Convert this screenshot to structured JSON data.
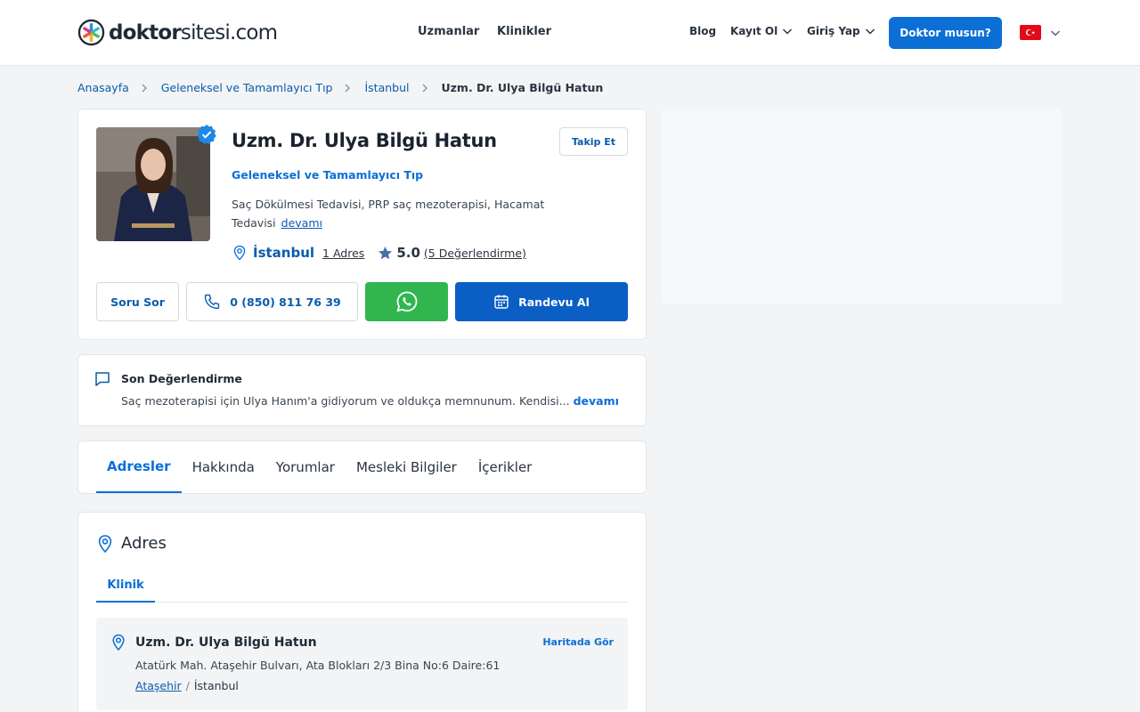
{
  "header": {
    "logo_bold": "doktor",
    "logo_light": "sitesi.com",
    "nav_center": [
      "Uzmanlar",
      "Klinikler"
    ],
    "blog": "Blog",
    "register": "Kayıt Ol",
    "login": "Giriş Yap",
    "doctor_cta": "Doktor musun?",
    "language_flag": "turkey-flag-icon"
  },
  "breadcrumb": [
    "Anasayfa",
    "Geleneksel ve Tamamlayıcı Tıp",
    "İstanbul",
    "Uzm. Dr. Ulya Bilgü Hatun"
  ],
  "profile": {
    "name": "Uzm. Dr. Ulya Bilgü Hatun",
    "follow": "Takip Et",
    "specialty": "Geleneksel ve Tamamlayıcı Tıp",
    "treatments": "Saç Dökülmesi Tedavisi, PRP saç mezoterapisi, Hacamat Tedavisi",
    "more": "devamı",
    "city": "İstanbul",
    "address_count": "1 Adres",
    "rating": "5.0",
    "reviews": "(5 Değerlendirme)",
    "actions": {
      "ask": "Soru Sor",
      "phone": "0 (850) 811 76 39",
      "appointment": "Randevu Al"
    }
  },
  "latest_review": {
    "title": "Son Değerlendirme",
    "text": "Saç mezoterapisi için Ulya Hanım'a gidiyorum ve oldukça memnunum. Kendisi...",
    "more": "devamı"
  },
  "tabs": [
    "Adresler",
    "Hakkında",
    "Yorumlar",
    "Mesleki Bilgiler",
    "İçerikler"
  ],
  "address_section": {
    "title": "Adres",
    "subtab": "Klinik",
    "clinic_name": "Uzm. Dr. Ulya Bilgü Hatun",
    "map_link": "Haritada Gör",
    "address": "Atatürk Mah. Ataşehir Bulvarı, Ata Blokları 2/3 Bina No:6 Daire:61",
    "district": "Ataşehir",
    "separator": "/",
    "city": "İstanbul"
  },
  "colors": {
    "brand_blue": "#0b6fd6",
    "whatsapp_green": "#31b64f",
    "appointment_blue": "#0b5ec4"
  }
}
